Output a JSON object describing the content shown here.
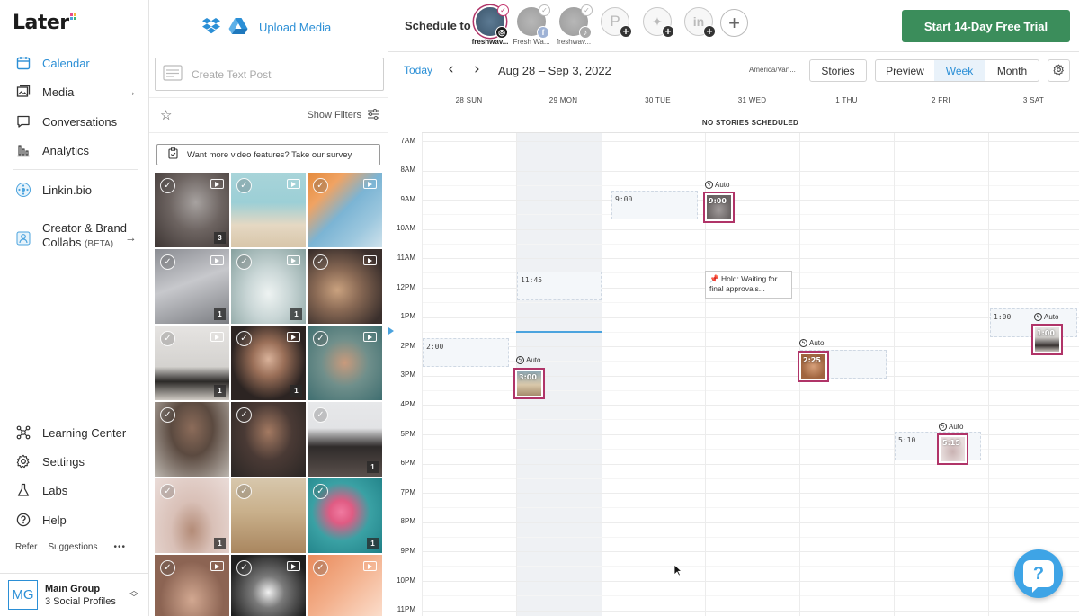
{
  "brand": {
    "name": "Later",
    "accent": "#2b8fd6",
    "trial_color": "#3b8d5b"
  },
  "sidebar": {
    "items": [
      {
        "label": "Calendar",
        "icon": "calendar-icon",
        "active": true
      },
      {
        "label": "Media",
        "icon": "image-icon"
      },
      {
        "label": "Conversations",
        "icon": "chat-icon"
      },
      {
        "label": "Analytics",
        "icon": "analytics-icon"
      },
      {
        "label": "Linkin.bio",
        "icon": "linkinbio-icon"
      },
      {
        "label": "Creator & Brand",
        "label2": "Collabs",
        "beta": "(BETA)",
        "icon": "collabs-icon"
      },
      {
        "label": "Learning Center",
        "icon": "learning-icon"
      },
      {
        "label": "Settings",
        "icon": "gear-icon"
      },
      {
        "label": "Labs",
        "icon": "flask-icon"
      },
      {
        "label": "Help",
        "icon": "help-icon"
      }
    ],
    "refer": "Refer",
    "suggestions": "Suggestions",
    "more": "•••",
    "account": {
      "initials": "MG",
      "group": "Main Group",
      "profiles": "3 Social Profiles"
    }
  },
  "media": {
    "upload_label": "Upload Media",
    "create_post_placeholder": "Create Text Post",
    "show_filters": "Show Filters",
    "survey_text": "Want more video features? Take our survey",
    "counts": [
      "3",
      "1",
      "1",
      "1",
      "1",
      "1",
      "1",
      "1"
    ]
  },
  "schedule": {
    "label": "Schedule to",
    "profiles": [
      {
        "name": "freshwav...",
        "network": "instagram",
        "selected": true
      },
      {
        "name": "Fresh Wa...",
        "network": "facebook"
      },
      {
        "name": "freshwav...",
        "network": "tiktok"
      },
      {
        "name": "",
        "network": "pinterest"
      },
      {
        "name": "",
        "network": "twitter"
      },
      {
        "name": "",
        "network": "linkedin"
      }
    ],
    "trial_button": "Start 14-Day Free Trial"
  },
  "calendar": {
    "today": "Today",
    "range": "Aug 28 – Sep 3, 2022",
    "timezone": "America/Van...",
    "stories": "Stories",
    "preview": "Preview",
    "week": "Week",
    "month": "Month",
    "days": [
      "28 SUN",
      "29 MON",
      "30 TUE",
      "31 WED",
      "1 THU",
      "2 FRI",
      "3 SAT"
    ],
    "no_stories": "NO STORIES SCHEDULED",
    "hours": [
      "7AM",
      "8AM",
      "9AM",
      "10AM",
      "11AM",
      "12PM",
      "1PM",
      "2PM",
      "3PM",
      "4PM",
      "5PM",
      "6PM",
      "7PM",
      "8PM",
      "9PM",
      "10PM",
      "11PM"
    ],
    "slots": [
      "9:00",
      "11:45",
      "2:00",
      "1:00",
      "5:10"
    ],
    "auto_label": "Auto",
    "posts": [
      "9:00",
      "3:00",
      "2:25",
      "5:15",
      "1:00"
    ],
    "hold_text": "Hold: Waiting for final approvals..."
  }
}
